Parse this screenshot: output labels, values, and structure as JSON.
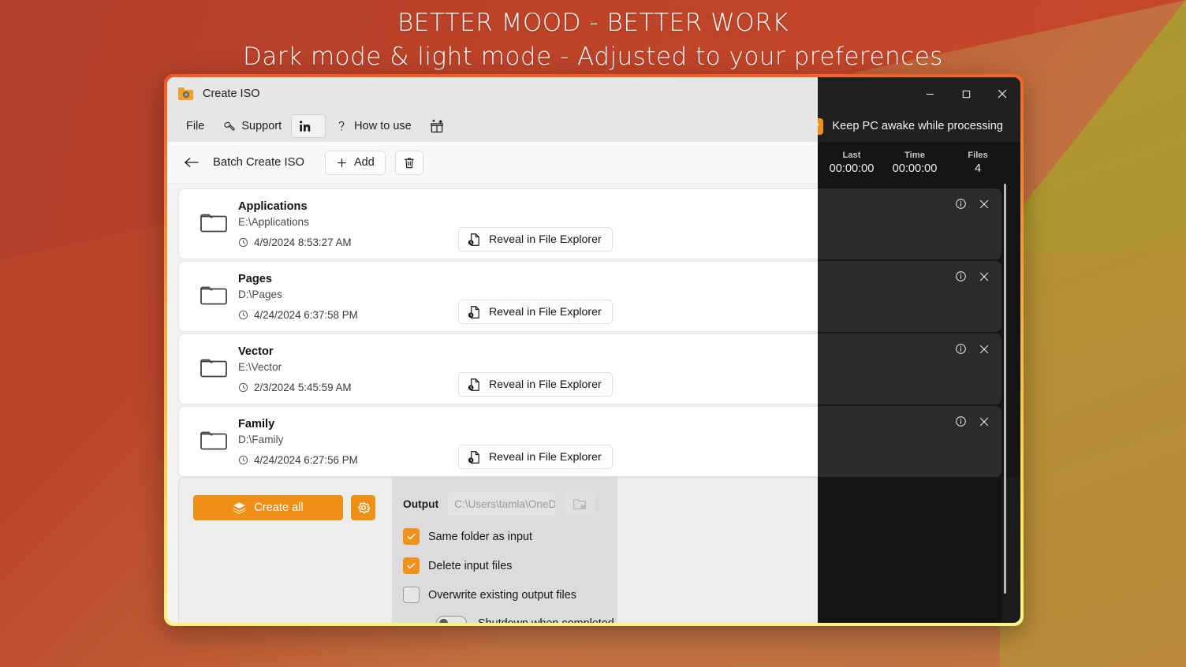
{
  "promo": {
    "line1": "BETTER MOOD - BETTER WORK",
    "line2": "Dark mode & light mode - Adjusted to your preferences"
  },
  "window": {
    "title": "Create ISO",
    "app_icon": "folder-disc-icon"
  },
  "window_controls": {
    "minimize": "minimize-icon",
    "maximize": "maximize-icon",
    "close": "close-icon"
  },
  "menubar": {
    "items": [
      {
        "label": "File",
        "icon": null,
        "boxed": false
      },
      {
        "label": "Support",
        "icon": "wrench-icon",
        "boxed": false
      },
      {
        "label": "",
        "icon": "linkedin-icon",
        "boxed": true
      },
      {
        "label": "How to use",
        "icon": "question-mark-icon",
        "boxed": false
      },
      {
        "label": "",
        "icon": "gift-sparkle-icon",
        "boxed": false
      }
    ]
  },
  "keep_awake": {
    "label": "Keep PC awake while processing",
    "checked": true
  },
  "toolbar": {
    "back_icon": "back-arrow-icon",
    "breadcrumb": "Batch Create ISO",
    "add_label": "Add",
    "add_icon": "plus-icon",
    "delete_icon": "trash-icon"
  },
  "stats": [
    {
      "key": "Last",
      "value": "00:00:00"
    },
    {
      "key": "Time",
      "value": "00:00:00"
    },
    {
      "key": "Files",
      "value": "4"
    }
  ],
  "rows": [
    {
      "name": "Applications",
      "path": "E:\\Applications",
      "datetime": "4/9/2024 8:53:27 AM",
      "reveal_label": "Reveal in File Explorer"
    },
    {
      "name": "Pages",
      "path": "D:\\Pages",
      "datetime": "4/24/2024 6:37:58 PM",
      "reveal_label": "Reveal in File Explorer"
    },
    {
      "name": "Vector",
      "path": "E:\\Vector",
      "datetime": "2/3/2024 5:45:59 AM",
      "reveal_label": "Reveal in File Explorer"
    },
    {
      "name": "Family",
      "path": "D:\\Family",
      "datetime": "4/24/2024 6:27:56 PM",
      "reveal_label": "Reveal in File Explorer"
    }
  ],
  "bottom": {
    "create_all_label": "Create all",
    "create_all_icon": "layers-icon",
    "settings_icon": "gear-icon",
    "output_label": "Output",
    "output_value": "",
    "output_placeholder": "C:\\Users\\tamla\\OneDrive\\",
    "browse_icon": "folder-browse-icon",
    "options": [
      {
        "label": "Same folder as input",
        "checked": true
      },
      {
        "label": "Delete input files",
        "checked": true
      },
      {
        "label": "Overwrite existing output files",
        "checked": false
      }
    ],
    "shutdown": {
      "label": "Shutdown when completed",
      "on": false
    }
  },
  "colors": {
    "accent": "#ef8f15",
    "frame_top": "#f05a28",
    "frame_bottom": "#fdf48a",
    "dark_bg": "#1b1b1b",
    "bg_red": "#bd4329",
    "bg_olive": "#b0972e"
  }
}
